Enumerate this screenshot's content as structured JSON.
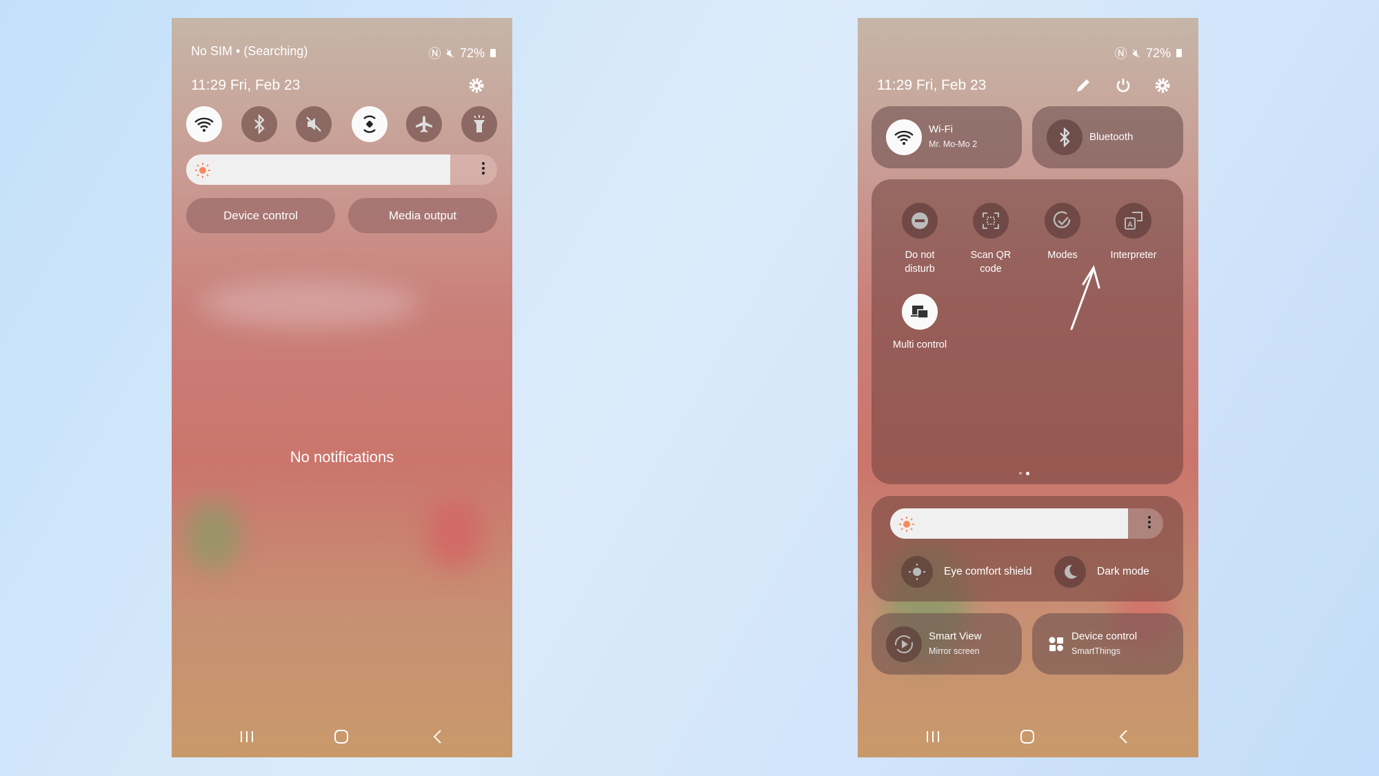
{
  "left_phone": {
    "status": {
      "carrier": "No SIM • (Searching)",
      "battery": "72%"
    },
    "datetime": "11:29  Fri, Feb 23",
    "toggles": [
      {
        "name": "wifi",
        "icon": "wifi-icon",
        "on": true
      },
      {
        "name": "bluetooth",
        "icon": "bluetooth-icon",
        "on": false
      },
      {
        "name": "sound",
        "icon": "mute-icon",
        "on": false
      },
      {
        "name": "auto-rotate",
        "icon": "rotate-icon",
        "on": true
      },
      {
        "name": "airplane",
        "icon": "airplane-icon",
        "on": false
      },
      {
        "name": "flashlight",
        "icon": "flashlight-icon",
        "on": false
      }
    ],
    "brightness_percent": 85,
    "buttons": {
      "device_control": "Device control",
      "media_output": "Media output"
    },
    "empty_message": "No notifications"
  },
  "right_phone": {
    "status": {
      "battery": "72%"
    },
    "datetime": "11:29  Fri, Feb 23",
    "wifi_tile": {
      "title": "Wi-Fi",
      "subtitle": "Mr. Mo-Mo 2"
    },
    "bluetooth_tile": {
      "title": "Bluetooth"
    },
    "quick_tiles": [
      {
        "label": "Do not disturb",
        "icon": "do-not-disturb-icon"
      },
      {
        "label": "Scan QR code",
        "icon": "qr-scan-icon"
      },
      {
        "label": "Modes",
        "icon": "modes-icon"
      },
      {
        "label": "Interpreter",
        "icon": "interpreter-icon"
      },
      {
        "label": "Multi control",
        "icon": "multi-control-icon"
      }
    ],
    "page_indicator": {
      "pages": 2,
      "current": 2
    },
    "brightness_percent": 87,
    "eye_comfort": "Eye comfort shield",
    "dark_mode": "Dark mode",
    "smart_view": {
      "title": "Smart View",
      "subtitle": "Mirror screen"
    },
    "device_control": {
      "title": "Device control",
      "subtitle": "SmartThings"
    }
  },
  "colors": {
    "accent_sun": "#f68a5c",
    "tile_on": "#fafafa"
  }
}
